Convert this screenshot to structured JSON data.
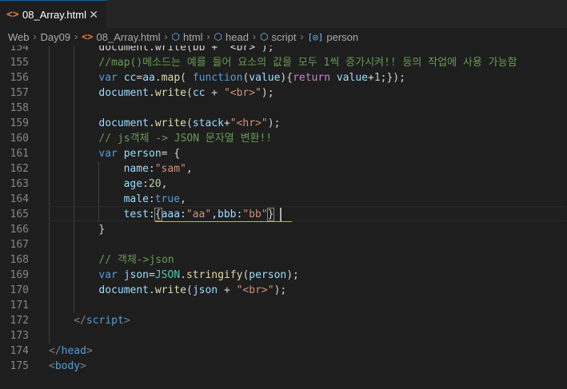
{
  "tab": {
    "icon": "<>",
    "label": "08_Array.html",
    "close": "✕"
  },
  "breadcrumb": [
    {
      "label": "Web",
      "icon": ""
    },
    {
      "label": "Day09",
      "icon": ""
    },
    {
      "label": "08_Array.html",
      "icon": "<>"
    },
    {
      "label": "html",
      "icon": "cube-icon"
    },
    {
      "label": "head",
      "icon": "cube-icon"
    },
    {
      "label": "script",
      "icon": "cube-icon"
    },
    {
      "label": "person",
      "icon": "variable-icon"
    }
  ],
  "colors": {
    "background": "#1e1e1e",
    "comment": "#6a9955",
    "keyword": "#569cd6",
    "string": "#ce9178",
    "warning_squiggle": "#d7a043"
  },
  "lines": [
    {
      "number": "154",
      "indent": 3,
      "tokens": [
        [
          "plain",
          "document.write(bb + \"<br>\");"
        ]
      ]
    },
    {
      "number": "155",
      "indent": 3,
      "tokens": [
        [
          "comment",
          "//map()메소드는 예를 들어 요소의 값을 모두 1씩 증가시켜!! 등의 작업에 사용 가능함"
        ]
      ]
    },
    {
      "number": "156",
      "indent": 3,
      "tokens": [
        [
          "keyword",
          "var "
        ],
        [
          "var",
          "cc"
        ],
        [
          "plain",
          "="
        ],
        [
          "var",
          "aa"
        ],
        [
          "plain",
          "."
        ],
        [
          "func",
          "map"
        ],
        [
          "plain",
          "( "
        ],
        [
          "keyword",
          "function"
        ],
        [
          "plain",
          "("
        ],
        [
          "var",
          "value"
        ],
        [
          "plain",
          "){"
        ],
        [
          "control",
          "return "
        ],
        [
          "var",
          "value"
        ],
        [
          "plain",
          "+"
        ],
        [
          "number",
          "1"
        ],
        [
          "plain",
          ";});"
        ]
      ]
    },
    {
      "number": "157",
      "indent": 3,
      "tokens": [
        [
          "var",
          "document"
        ],
        [
          "plain",
          "."
        ],
        [
          "func",
          "write"
        ],
        [
          "plain",
          "("
        ],
        [
          "var",
          "cc"
        ],
        [
          "plain",
          " + "
        ],
        [
          "string",
          "\"<br>\""
        ],
        [
          "plain",
          ");"
        ]
      ]
    },
    {
      "number": "158",
      "indent": 3,
      "tokens": []
    },
    {
      "number": "159",
      "indent": 3,
      "tokens": [
        [
          "var",
          "document"
        ],
        [
          "plain",
          "."
        ],
        [
          "func",
          "write"
        ],
        [
          "plain",
          "("
        ],
        [
          "var",
          "stack"
        ],
        [
          "plain",
          "+"
        ],
        [
          "string",
          "\"<hr>\""
        ],
        [
          "plain",
          ");"
        ]
      ]
    },
    {
      "number": "160",
      "indent": 3,
      "tokens": [
        [
          "comment",
          "// js객체 -> JSON 문자열 변환!!"
        ]
      ]
    },
    {
      "number": "161",
      "indent": 3,
      "tokens": [
        [
          "keyword",
          "var "
        ],
        [
          "var",
          "person"
        ],
        [
          "plain",
          "= {"
        ]
      ]
    },
    {
      "number": "162",
      "indent": 4,
      "tokens": [
        [
          "var",
          "name"
        ],
        [
          "plain",
          ":"
        ],
        [
          "string",
          "\"sam\""
        ],
        [
          "plain",
          ","
        ]
      ]
    },
    {
      "number": "163",
      "indent": 4,
      "tokens": [
        [
          "var",
          "age"
        ],
        [
          "plain",
          ":"
        ],
        [
          "number",
          "20"
        ],
        [
          "plain",
          ","
        ]
      ]
    },
    {
      "number": "164",
      "indent": 4,
      "tokens": [
        [
          "var",
          "male"
        ],
        [
          "plain",
          ":"
        ],
        [
          "keyword",
          "true"
        ],
        [
          "plain",
          ","
        ]
      ]
    },
    {
      "number": "165",
      "indent": 4,
      "tokens": [
        [
          "var",
          "test"
        ],
        [
          "plain",
          ":"
        ],
        [
          "box",
          "{"
        ],
        [
          "var",
          "aaa"
        ],
        [
          "plain",
          ":"
        ],
        [
          "string",
          "\"aa\""
        ],
        [
          "plain",
          ","
        ],
        [
          "var",
          "bbb"
        ],
        [
          "plain",
          ":"
        ],
        [
          "string",
          "\"bb\""
        ],
        [
          "box",
          "}"
        ]
      ]
    },
    {
      "number": "166",
      "indent": 3,
      "tokens": [
        [
          "plain",
          "}"
        ]
      ]
    },
    {
      "number": "167",
      "indent": 3,
      "tokens": []
    },
    {
      "number": "168",
      "indent": 3,
      "tokens": [
        [
          "comment",
          "// 객체->json"
        ]
      ]
    },
    {
      "number": "169",
      "indent": 3,
      "tokens": [
        [
          "keyword",
          "var "
        ],
        [
          "var",
          "json"
        ],
        [
          "plain",
          "="
        ],
        [
          "class",
          "JSON"
        ],
        [
          "plain",
          "."
        ],
        [
          "func",
          "stringify"
        ],
        [
          "plain",
          "("
        ],
        [
          "var",
          "person"
        ],
        [
          "plain",
          ");"
        ]
      ]
    },
    {
      "number": "170",
      "indent": 3,
      "tokens": [
        [
          "var",
          "document"
        ],
        [
          "plain",
          "."
        ],
        [
          "func",
          "write"
        ],
        [
          "plain",
          "("
        ],
        [
          "var",
          "json"
        ],
        [
          "plain",
          " + "
        ],
        [
          "string",
          "\"<br>\""
        ],
        [
          "plain",
          ");"
        ]
      ]
    },
    {
      "number": "171",
      "indent": 3,
      "tokens": []
    },
    {
      "number": "172",
      "indent": 2,
      "tokens": [
        [
          "tagbr",
          "</"
        ],
        [
          "tag",
          "script"
        ],
        [
          "tagbr",
          ">"
        ]
      ]
    },
    {
      "number": "173",
      "indent": 2,
      "tokens": []
    },
    {
      "number": "174",
      "indent": 1,
      "tokens": [
        [
          "tagbr",
          "</"
        ],
        [
          "tag",
          "head"
        ],
        [
          "tagbr",
          ">"
        ]
      ]
    },
    {
      "number": "175",
      "indent": 1,
      "tokens": [
        [
          "tagbr",
          "<"
        ],
        [
          "tag",
          "body"
        ],
        [
          "tagbr",
          ">"
        ]
      ]
    }
  ]
}
